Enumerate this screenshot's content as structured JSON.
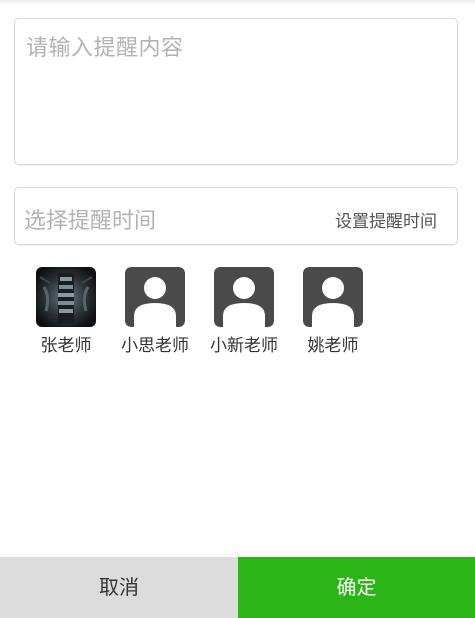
{
  "reminder": {
    "content_placeholder": "请输入提醒内容",
    "time_label": "选择提醒时间",
    "set_time_label": "设置提醒时间"
  },
  "teachers": [
    {
      "name": "张老师",
      "avatar": "photo-avatar"
    },
    {
      "name": "小思老师",
      "avatar": "default-avatar-icon"
    },
    {
      "name": "小新老师",
      "avatar": "default-avatar-icon"
    },
    {
      "name": "姚老师",
      "avatar": "default-avatar-icon"
    }
  ],
  "actions": {
    "cancel_label": "取消",
    "confirm_label": "确定"
  },
  "colors": {
    "confirm_bg": "#2bb516",
    "cancel_bg": "#dcdcdc",
    "avatar_icon_bg": "#4a4a4a"
  }
}
